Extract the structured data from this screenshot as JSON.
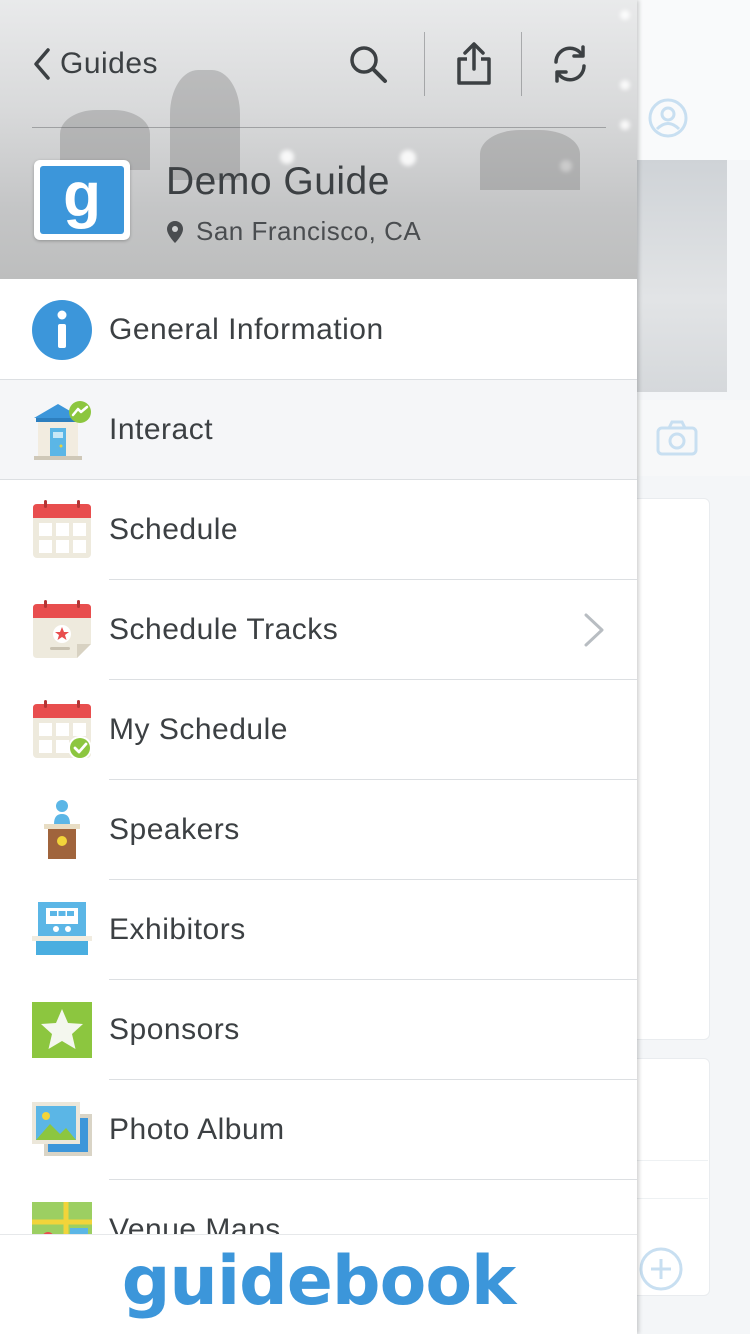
{
  "header": {
    "back_label": "Guides",
    "guide_title": "Demo Guide",
    "guide_location": "San Francisco, CA",
    "logo_letter": "g",
    "icons": {
      "back": "chevron-left-icon",
      "search": "search-icon",
      "share": "share-icon",
      "refresh": "refresh-icon",
      "location": "map-pin-icon"
    }
  },
  "menu": {
    "items": [
      {
        "label": "General Information",
        "icon": "info-icon",
        "active": false,
        "has_chevron": false
      },
      {
        "label": "Interact",
        "icon": "interact-house-icon",
        "active": true,
        "has_chevron": false
      },
      {
        "label": "Schedule",
        "icon": "calendar-icon",
        "active": false,
        "has_chevron": false
      },
      {
        "label": "Schedule Tracks",
        "icon": "calendar-star-icon",
        "active": false,
        "has_chevron": true
      },
      {
        "label": "My Schedule",
        "icon": "calendar-check-icon",
        "active": false,
        "has_chevron": false
      },
      {
        "label": "Speakers",
        "icon": "podium-icon",
        "active": false,
        "has_chevron": false
      },
      {
        "label": "Exhibitors",
        "icon": "booth-icon",
        "active": false,
        "has_chevron": false
      },
      {
        "label": "Sponsors",
        "icon": "star-icon",
        "active": false,
        "has_chevron": false
      },
      {
        "label": "Photo Album",
        "icon": "photo-icon",
        "active": false,
        "has_chevron": false
      },
      {
        "label": "Venue Maps",
        "icon": "map-icon",
        "active": false,
        "has_chevron": false
      }
    ]
  },
  "footer": {
    "brand": "guidebook"
  },
  "colors": {
    "accent": "#3c96da",
    "text": "#3c4043",
    "active_row": "#f5f6f8",
    "separator": "#dcdfe2"
  }
}
